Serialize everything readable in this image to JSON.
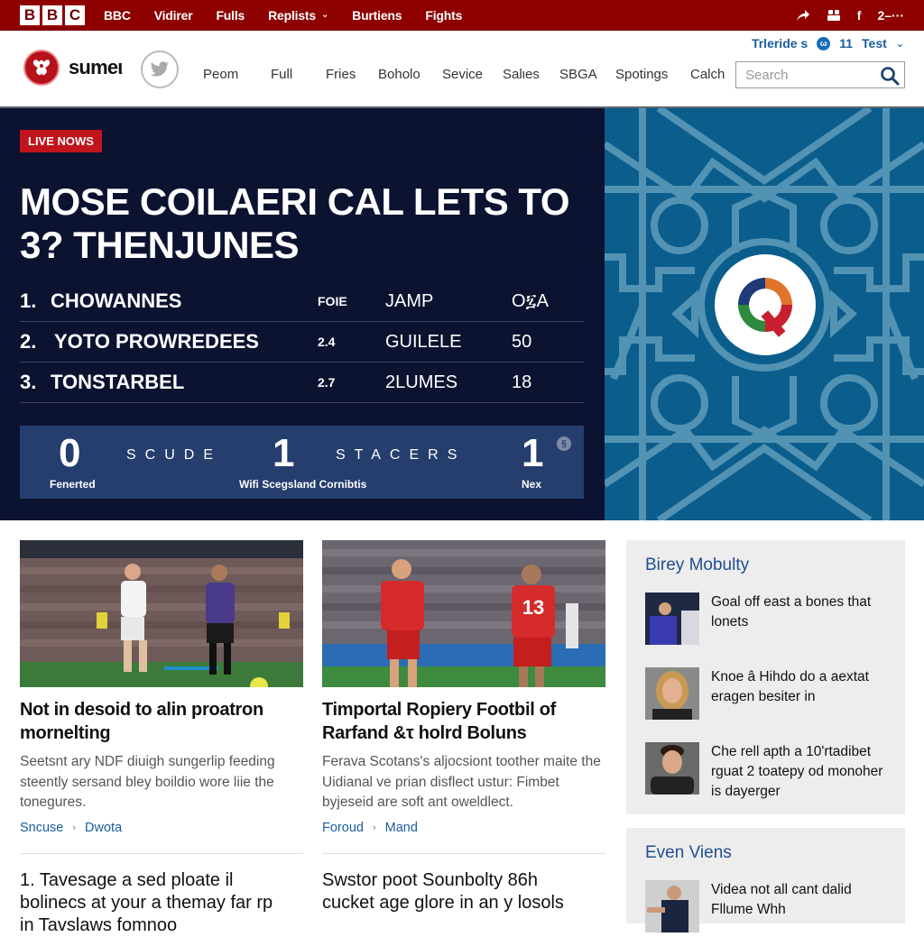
{
  "topbar": {
    "brand_letters": [
      "B",
      "B",
      "C"
    ],
    "nav": [
      {
        "label": "BBC"
      },
      {
        "label": "Vidirer"
      },
      {
        "label": "Fulls"
      },
      {
        "label": "Replists",
        "has_dropdown": true
      },
      {
        "label": "Burtiens"
      },
      {
        "label": "Fights"
      }
    ],
    "right": {
      "share_icon": "share-arrow-icon",
      "people_icon": "people-icon",
      "facebook_label": "f",
      "extra_label": "2–···"
    }
  },
  "header": {
    "logo_text": "sumeι",
    "logo_icon": "crest-logo-icon",
    "social_icon": "twitter-icon",
    "nav": [
      "Peom",
      "Full",
      "Fries",
      "Boholo",
      "Sevice",
      "Salιes",
      "SBGA",
      "Spotings",
      "Calch"
    ],
    "util": {
      "link_label": "Trleride s",
      "badge_icon": "notification-badge-icon",
      "count": "11",
      "user_label": "Test"
    },
    "search": {
      "placeholder": "Search",
      "value": ""
    }
  },
  "hero": {
    "live_label": "LIVE NOWS",
    "title": "MOSE COILAERI CAL LETS TO 3? THENJUNES",
    "standings": [
      {
        "rank": "1.",
        "team": "CHOWANNES",
        "c1": "FOIE",
        "c2": "JAMP",
        "c3": "O፯A"
      },
      {
        "rank": "2.",
        "team": "YOTO PROWREDEES",
        "c1": "2.4",
        "c2": "GUILELE",
        "c3": "50"
      },
      {
        "rank": "3.",
        "team": "TONSTARBEL",
        "c1": "2.7",
        "c2": "2LUMES",
        "c3": "18"
      }
    ],
    "score": {
      "left_num": "0",
      "left_sub": "Fenerted",
      "label1": "SCUDE",
      "mid_num": "1",
      "mid_sub": "Wifi Scegsland Cornibtis",
      "label2": "STACERS",
      "right_num": "1",
      "right_sub": "Nex",
      "info_icon": "info-icon"
    },
    "emblem_icon": "q-emblem-icon",
    "pattern_color": "#0b5d8c"
  },
  "cards": [
    {
      "image": "football-players-white-vs-purple",
      "title": "Not in desoid to alin proatron mornelting",
      "body": "Seetsnt ary NDF diuigh sungerlip feeding steently sersand bley boildio wore liie the tonegures.",
      "tag1": "Sncuse",
      "tag2": "Dwota"
    },
    {
      "image": "football-players-red-kits",
      "title": "Timportal Ropiery Footbil of Rarfand &τ holrd Boluns",
      "body": "Ferava Scotans's aljocsiont toother maite the Uidianal ve prian disflect ustur: Fimbet byjeseid are soft ant oweldlect.",
      "tag1": "Foroud",
      "tag2": "Mand"
    }
  ],
  "bottom_stories": [
    "1. Tavesage a sed ploate il bolinecs at your a themay far rp in Tavslaws fomnoo",
    "Swstor poot Sounbolty 86h cucket age glore in an y losols"
  ],
  "sidebar": {
    "box1": {
      "title": "Birey Mobulty",
      "items": [
        {
          "thumb": "player-celebrating-thumb",
          "text": "Goal off east a bones that lonets"
        },
        {
          "thumb": "woman-portrait-thumb",
          "text": "Knoe â Hihdo do a aextat eragen besiter in"
        },
        {
          "thumb": "man-portrait-thumb",
          "text": "Che rell apth a 10'rtadibet rguat 2 toatepy od monoher is dayerger"
        }
      ]
    },
    "box2": {
      "title": "Even Viens",
      "items": [
        {
          "thumb": "player-action-thumb",
          "text": "Videa not all cant dalid Fllume Whh"
        }
      ]
    }
  },
  "colors": {
    "brand_red": "#8e0000",
    "live_red": "#c1141c",
    "hero_navy": "#0c1330",
    "score_blue": "#253e6e",
    "link_blue": "#1a5c9e",
    "pattern_teal": "#0b5d8c"
  }
}
